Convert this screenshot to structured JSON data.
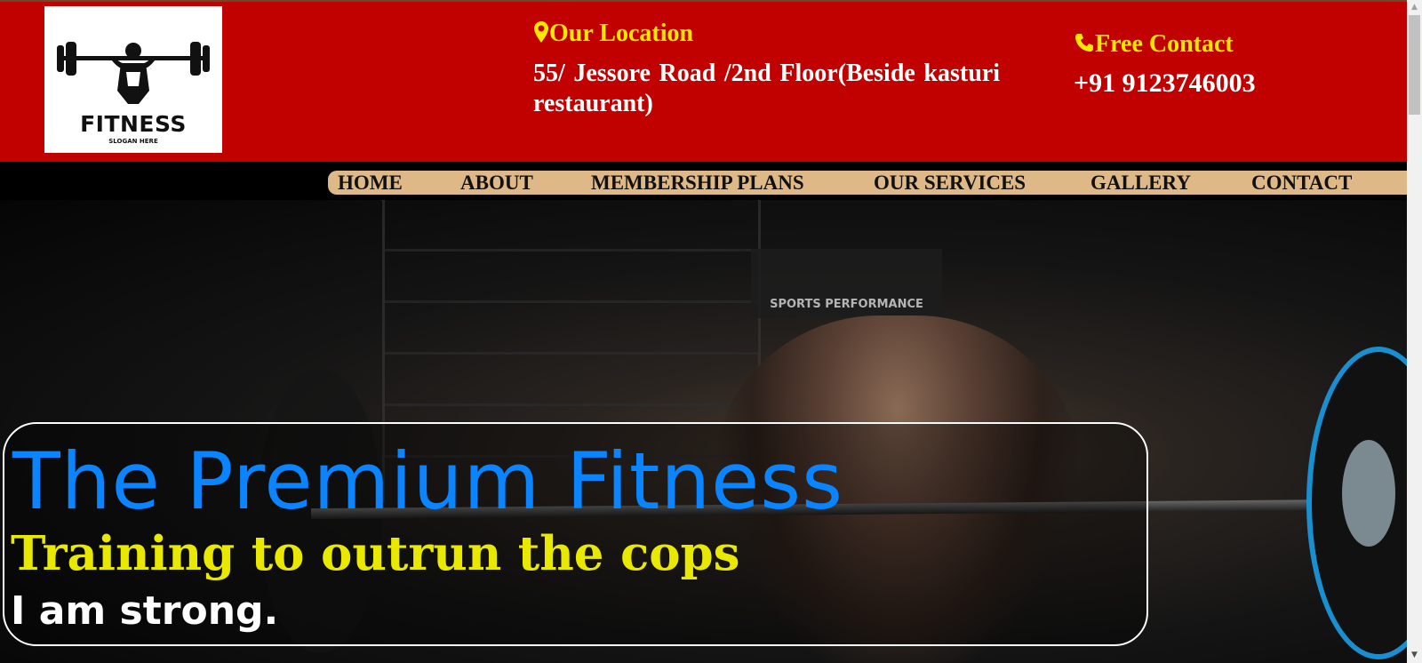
{
  "header": {
    "logo": {
      "title": "FITNESS",
      "slogan": "SLOGAN HERE"
    },
    "location": {
      "icon": "map-pin-icon",
      "heading": "Our Location",
      "address": "55/ Jessore Road /2nd Floor(Beside kasturi restaurant)"
    },
    "contact": {
      "icon": "phone-icon",
      "heading": "Free Contact",
      "phone": "+91 9123746003"
    }
  },
  "nav": {
    "items": [
      {
        "label": "HOME"
      },
      {
        "label": "ABOUT"
      },
      {
        "label": "MEMBERSHIP PLANS"
      },
      {
        "label": "OUR SERVICES"
      },
      {
        "label": "GALLERY"
      },
      {
        "label": "CONTACT"
      }
    ]
  },
  "hero": {
    "sign_text": "SPORTS PERFORMANCE",
    "title": "The Premium Fitness",
    "subtitle": "Training to outrun the cops",
    "tagline": "I am strong."
  },
  "colors": {
    "header_bg": "#c10000",
    "nav_bg": "#deb887",
    "accent_yellow": "#ffe600",
    "title_blue": "#0a84ff"
  }
}
